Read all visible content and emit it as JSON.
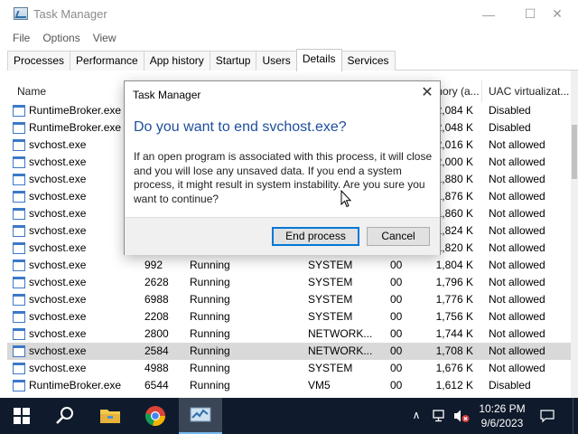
{
  "window": {
    "title": "Task Manager",
    "min_glyph": "—",
    "max_glyph": "☐",
    "close_glyph": "✕"
  },
  "menu": [
    "File",
    "Options",
    "View"
  ],
  "tabs": [
    {
      "label": "Processes",
      "active": false
    },
    {
      "label": "Performance",
      "active": false
    },
    {
      "label": "App history",
      "active": false
    },
    {
      "label": "Startup",
      "active": false
    },
    {
      "label": "Users",
      "active": false
    },
    {
      "label": "Details",
      "active": true
    },
    {
      "label": "Services",
      "active": false
    }
  ],
  "table": {
    "columns": {
      "name": "Name",
      "memory": "mory (a...",
      "uac": "UAC virtualizat..."
    },
    "rows": [
      {
        "name": "RuntimeBroker.exe",
        "pid": "",
        "status": "",
        "user": "",
        "cpu": "",
        "mem": "2,084 K",
        "uac": "Disabled",
        "selected": false
      },
      {
        "name": "RuntimeBroker.exe",
        "pid": "",
        "status": "",
        "user": "",
        "cpu": "",
        "mem": "2,048 K",
        "uac": "Disabled",
        "selected": false
      },
      {
        "name": "svchost.exe",
        "pid": "",
        "status": "",
        "user": "",
        "cpu": "",
        "mem": "2,016 K",
        "uac": "Not allowed",
        "selected": false
      },
      {
        "name": "svchost.exe",
        "pid": "",
        "status": "",
        "user": "",
        "cpu": "",
        "mem": "2,000 K",
        "uac": "Not allowed",
        "selected": false
      },
      {
        "name": "svchost.exe",
        "pid": "",
        "status": "",
        "user": "",
        "cpu": "",
        "mem": "1,880 K",
        "uac": "Not allowed",
        "selected": false
      },
      {
        "name": "svchost.exe",
        "pid": "",
        "status": "",
        "user": "",
        "cpu": "",
        "mem": "1,876 K",
        "uac": "Not allowed",
        "selected": false
      },
      {
        "name": "svchost.exe",
        "pid": "",
        "status": "",
        "user": "",
        "cpu": "",
        "mem": "1,860 K",
        "uac": "Not allowed",
        "selected": false
      },
      {
        "name": "svchost.exe",
        "pid": "",
        "status": "",
        "user": "",
        "cpu": "",
        "mem": "1,824 K",
        "uac": "Not allowed",
        "selected": false
      },
      {
        "name": "svchost.exe",
        "pid": "",
        "status": "",
        "user": "",
        "cpu": "",
        "mem": "1,820 K",
        "uac": "Not allowed",
        "selected": false
      },
      {
        "name": "svchost.exe",
        "pid": "992",
        "status": "Running",
        "user": "SYSTEM",
        "cpu": "00",
        "mem": "1,804 K",
        "uac": "Not allowed",
        "selected": false
      },
      {
        "name": "svchost.exe",
        "pid": "2628",
        "status": "Running",
        "user": "SYSTEM",
        "cpu": "00",
        "mem": "1,796 K",
        "uac": "Not allowed",
        "selected": false
      },
      {
        "name": "svchost.exe",
        "pid": "6988",
        "status": "Running",
        "user": "SYSTEM",
        "cpu": "00",
        "mem": "1,776 K",
        "uac": "Not allowed",
        "selected": false
      },
      {
        "name": "svchost.exe",
        "pid": "2208",
        "status": "Running",
        "user": "SYSTEM",
        "cpu": "00",
        "mem": "1,756 K",
        "uac": "Not allowed",
        "selected": false
      },
      {
        "name": "svchost.exe",
        "pid": "2800",
        "status": "Running",
        "user": "NETWORK...",
        "cpu": "00",
        "mem": "1,744 K",
        "uac": "Not allowed",
        "selected": false
      },
      {
        "name": "svchost.exe",
        "pid": "2584",
        "status": "Running",
        "user": "NETWORK...",
        "cpu": "00",
        "mem": "1,708 K",
        "uac": "Not allowed",
        "selected": true
      },
      {
        "name": "svchost.exe",
        "pid": "4988",
        "status": "Running",
        "user": "SYSTEM",
        "cpu": "00",
        "mem": "1,676 K",
        "uac": "Not allowed",
        "selected": false
      },
      {
        "name": "RuntimeBroker.exe",
        "pid": "6544",
        "status": "Running",
        "user": "VM5",
        "cpu": "00",
        "mem": "1,612 K",
        "uac": "Disabled",
        "selected": false
      }
    ]
  },
  "dialog": {
    "title": "Task Manager",
    "heading": "Do you want to end svchost.exe?",
    "body": "If an open program is associated with this process, it will close and you will lose any unsaved data. If you end a system process, it might result in system instability. Are you sure you want to continue?",
    "primary_button": "End process",
    "cancel_button": "Cancel",
    "close_glyph": "✕"
  },
  "taskbar": {
    "time": "10:26 PM",
    "date": "9/6/2023",
    "tray_chevron": "∧"
  },
  "colors": {
    "accent": "#0078d7",
    "dialog_heading": "#1e4e9c",
    "taskbar": "#0f1b2c",
    "selected_row": "#d9d9d9"
  }
}
